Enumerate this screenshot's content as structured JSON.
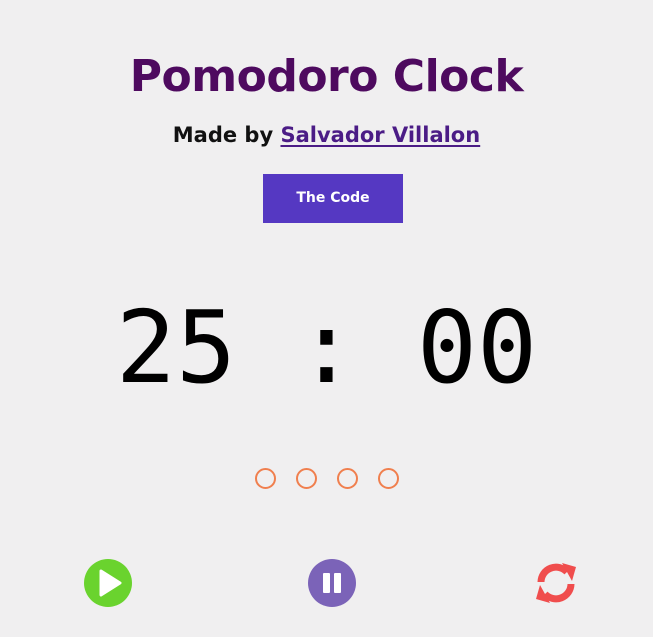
{
  "header": {
    "title": "Pomodoro Clock",
    "credit_prefix": "Made by",
    "credit_link": "Salvador Villalon",
    "code_button": "The Code"
  },
  "timer": {
    "minutes": "25",
    "separator": ":",
    "seconds": "00"
  },
  "sessions": {
    "total": 4,
    "completed": 0,
    "indicator_color": "#f07f4e"
  },
  "controls": {
    "play_icon": "play-icon",
    "pause_icon": "pause-icon",
    "reset_icon": "refresh-icon",
    "play_color": "#6ad32e",
    "pause_color": "#7b63b8",
    "reset_color": "#f04d4d"
  },
  "colors": {
    "title": "#4e0a5f",
    "link": "#4b1c86",
    "button_bg": "#5538c2",
    "background": "#f0eff0"
  }
}
